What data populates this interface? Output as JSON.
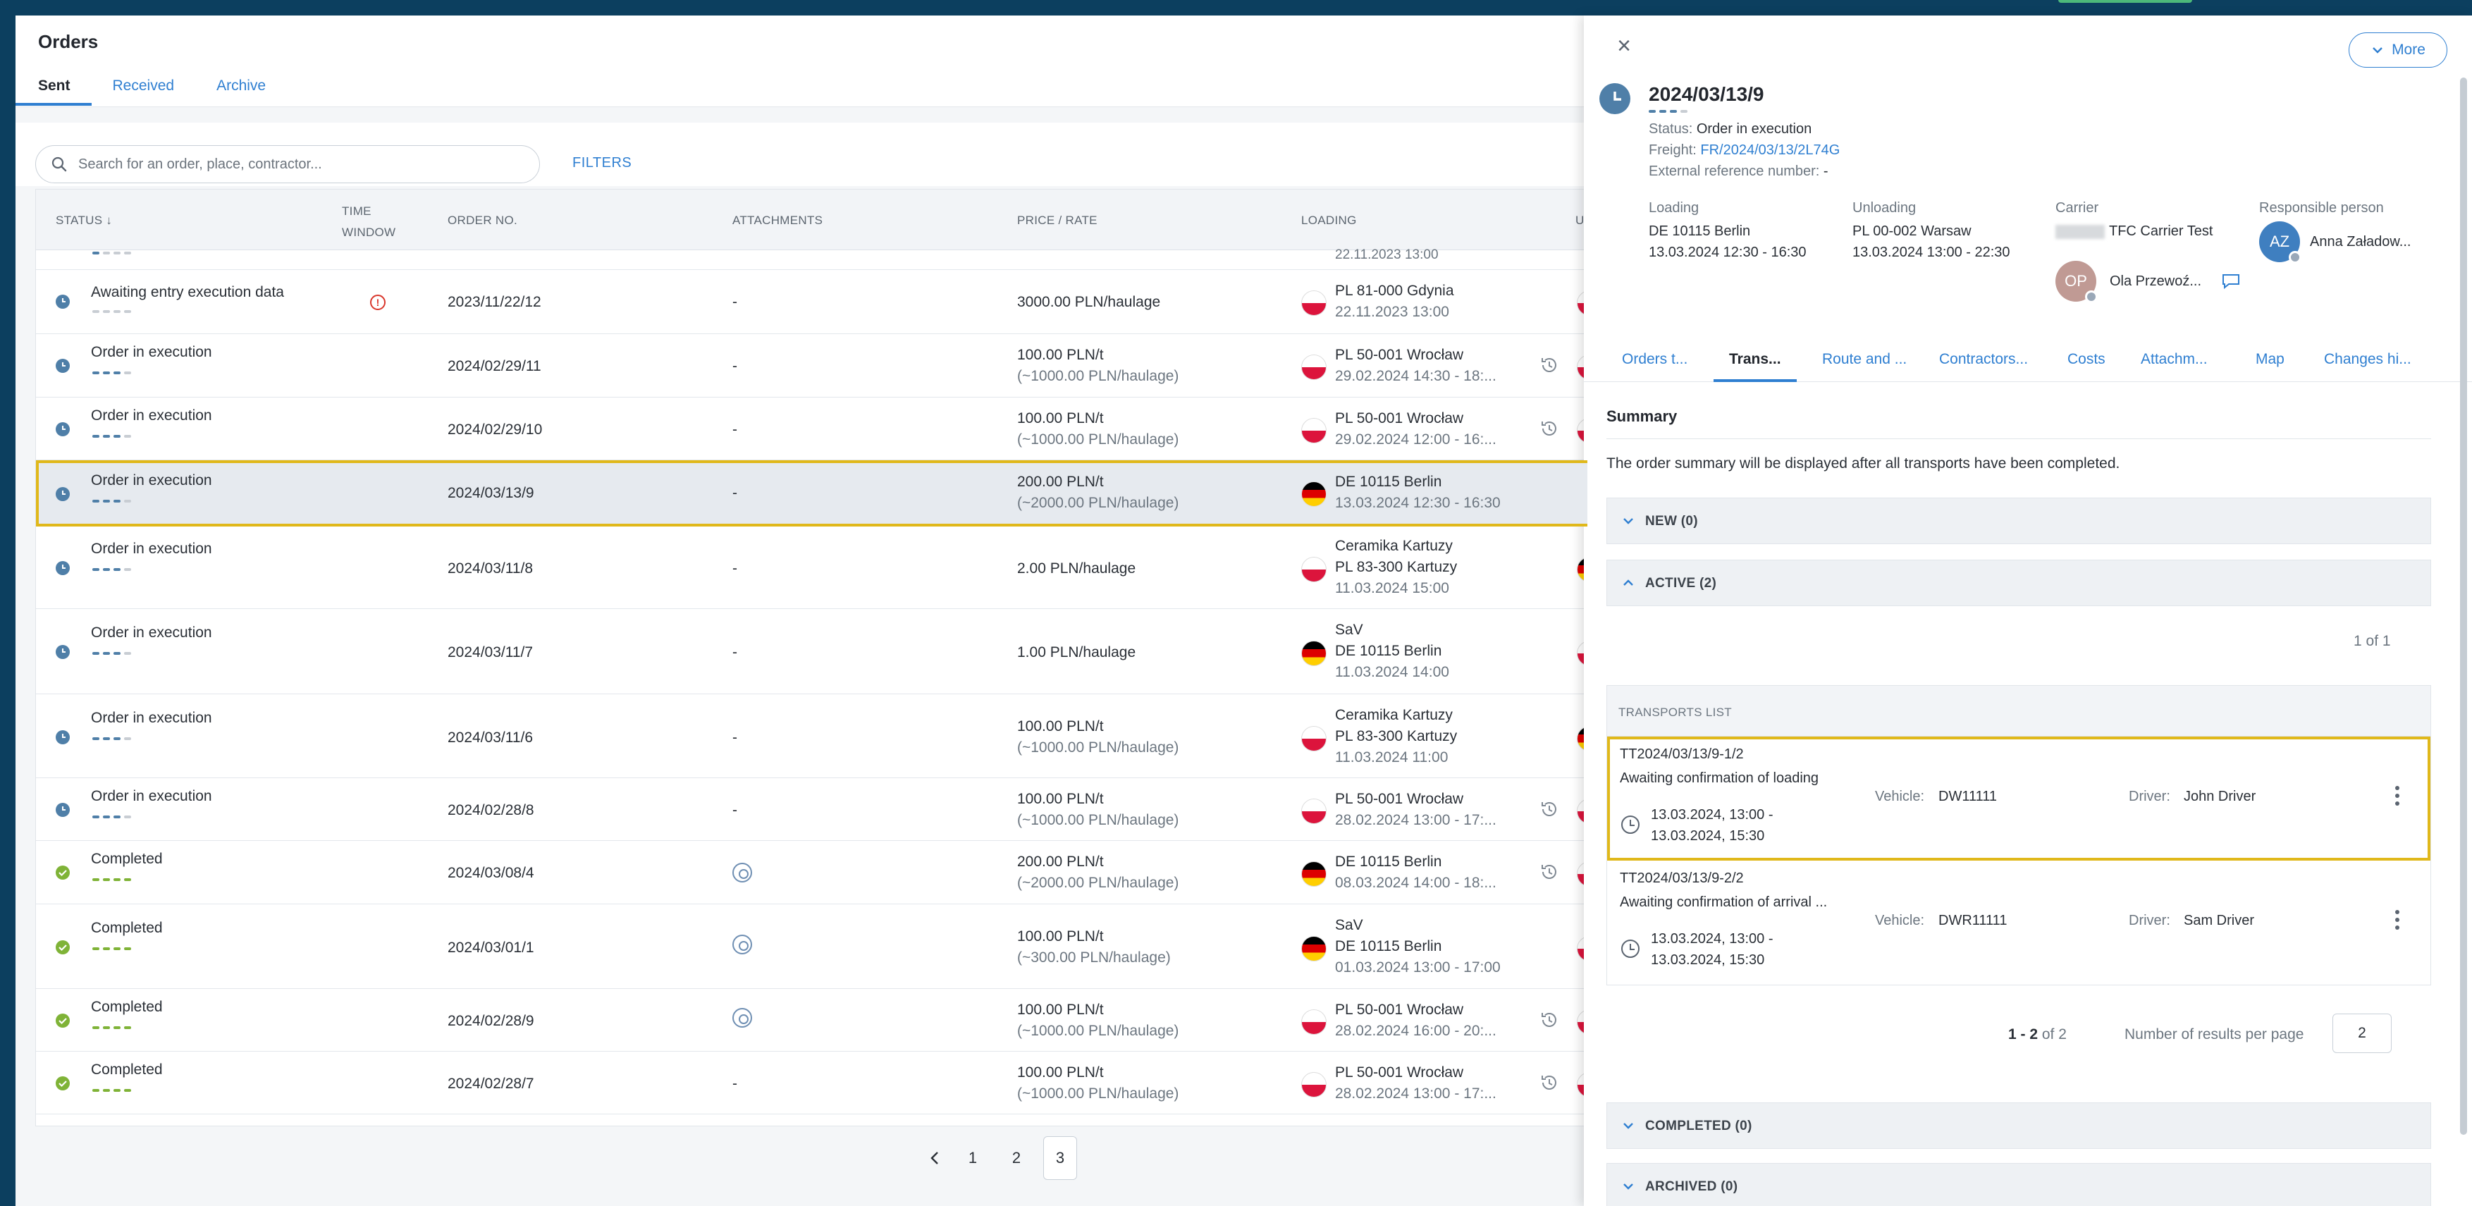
{
  "page_title": "Orders",
  "tabs": [
    "Sent",
    "Received",
    "Archive"
  ],
  "search": {
    "placeholder": "Search for an order, place, contractor..."
  },
  "filters_label": "FILTERS",
  "columns": {
    "status": "STATUS ↓",
    "time_window": "TIME WINDOW",
    "order_no": "ORDER NO.",
    "attachments": "ATTACHMENTS",
    "price": "PRICE / RATE",
    "loading": "LOADING",
    "unloading_partial": "U"
  },
  "partial_top_row": {
    "loading_sub": "22.11.2023 13:00"
  },
  "rows": [
    {
      "status": "Awaiting entry execution data",
      "order_no": "2023/11/22/12",
      "attachments": "-",
      "price": "3000.00 PLN/haulage",
      "price_sub": "",
      "loading_1": "PL 81-000 Gdynia",
      "loading_2": "22.11.2023 13:00",
      "loading_3": ""
    },
    {
      "status": "Order in execution",
      "order_no": "2024/02/29/11",
      "attachments": "-",
      "price": "100.00 PLN/t",
      "price_sub": "(~1000.00 PLN/haulage)",
      "loading_1": "PL 50-001 Wrocław",
      "loading_2": "29.02.2024 14:30 - 18:...",
      "loading_3": ""
    },
    {
      "status": "Order in execution",
      "order_no": "2024/02/29/10",
      "attachments": "-",
      "price": "100.00 PLN/t",
      "price_sub": "(~1000.00 PLN/haulage)",
      "loading_1": "PL 50-001 Wrocław",
      "loading_2": "29.02.2024 12:00 - 16:...",
      "loading_3": ""
    },
    {
      "status": "Order in execution",
      "order_no": "2024/03/13/9",
      "attachments": "-",
      "price": "200.00 PLN/t",
      "price_sub": "(~2000.00 PLN/haulage)",
      "loading_1": "DE 10115 Berlin",
      "loading_2": "13.03.2024 12:30 - 16:30",
      "loading_3": ""
    },
    {
      "status": "Order in execution",
      "order_no": "2024/03/11/8",
      "attachments": "-",
      "price": "2.00 PLN/haulage",
      "price_sub": "",
      "loading_1": "Ceramika Kartuzy",
      "loading_2": "PL 83-300 Kartuzy",
      "loading_3": "11.03.2024 15:00"
    },
    {
      "status": "Order in execution",
      "order_no": "2024/03/11/7",
      "attachments": "-",
      "price": "1.00 PLN/haulage",
      "price_sub": "",
      "loading_1": "SaV",
      "loading_2": "DE 10115 Berlin",
      "loading_3": "11.03.2024 14:00"
    },
    {
      "status": "Order in execution",
      "order_no": "2024/03/11/6",
      "attachments": "-",
      "price": "100.00 PLN/t",
      "price_sub": "(~1000.00 PLN/haulage)",
      "loading_1": "Ceramika Kartuzy",
      "loading_2": "PL 83-300 Kartuzy",
      "loading_3": "11.03.2024 11:00"
    },
    {
      "status": "Order in execution",
      "order_no": "2024/02/28/8",
      "attachments": "-",
      "price": "100.00 PLN/t",
      "price_sub": "(~1000.00 PLN/haulage)",
      "loading_1": "PL 50-001 Wrocław",
      "loading_2": "28.02.2024 13:00 - 17:...",
      "loading_3": ""
    },
    {
      "status": "Completed",
      "order_no": "2024/03/08/4",
      "attachments": "",
      "price": "200.00 PLN/t",
      "price_sub": "(~2000.00 PLN/haulage)",
      "loading_1": "DE 10115 Berlin",
      "loading_2": "08.03.2024 14:00 - 18:...",
      "loading_3": ""
    },
    {
      "status": "Completed",
      "order_no": "2024/03/01/1",
      "attachments": "",
      "price": "100.00 PLN/t",
      "price_sub": "(~300.00 PLN/haulage)",
      "loading_1": "SaV",
      "loading_2": "DE 10115 Berlin",
      "loading_3": "01.03.2024 13:00 - 17:00"
    },
    {
      "status": "Completed",
      "order_no": "2024/02/28/9",
      "attachments": "",
      "price": "100.00 PLN/t",
      "price_sub": "(~1000.00 PLN/haulage)",
      "loading_1": "PL 50-001 Wrocław",
      "loading_2": "28.02.2024 16:00 - 20:...",
      "loading_3": ""
    },
    {
      "status": "Completed",
      "order_no": "2024/02/28/7",
      "attachments": "-",
      "price": "100.00 PLN/t",
      "price_sub": "(~1000.00 PLN/haulage)",
      "loading_1": "PL 50-001 Wrocław",
      "loading_2": "28.02.2024 13:00 - 17:...",
      "loading_3": ""
    }
  ],
  "pagination": [
    "1",
    "2",
    "3"
  ],
  "detail": {
    "more_label": "More",
    "order_no": "2024/03/13/9",
    "status_label": "Status:",
    "status_value": "Order in execution",
    "freight_label": "Freight:",
    "freight_value": "FR/2024/03/13/2L74G",
    "extref_label": "External reference number:",
    "extref_value": "-",
    "loading_label": "Loading",
    "loading_place": "DE 10115 Berlin",
    "loading_time": "13.03.2024 12:30 - 16:30",
    "unloading_label": "Unloading",
    "unloading_place": "PL 00-002 Warsaw",
    "unloading_time": "13.03.2024 13:00 - 22:30",
    "carrier_label": "Carrier",
    "carrier_name": "TFC Carrier Test",
    "carrier_person_initials": "OP",
    "carrier_person": "Ola Przewoź...",
    "responsible_label": "Responsible person",
    "responsible_initials": "AZ",
    "responsible_name": "Anna Załadow...",
    "tabs": [
      "Orders t...",
      "Trans...",
      "Route and ...",
      "Contractors...",
      "Costs",
      "Attachm...",
      "Map",
      "Changes hi..."
    ],
    "summary_title": "Summary",
    "summary_text": "The order summary will be displayed after all transports have been completed.",
    "section_new": "NEW (0)",
    "section_active": "ACTIVE (2)",
    "counter": "1 of 1",
    "transports_list": "TRANSPORTS LIST",
    "transports": [
      {
        "id": "TT2024/03/13/9-1/2",
        "status": "Awaiting confirmation of loading",
        "date_1": "13.03.2024, 13:00 -",
        "date_2": "13.03.2024, 15:30",
        "vehicle_label": "Vehicle:",
        "vehicle": "DW11111",
        "driver_label": "Driver:",
        "driver": "John Driver"
      },
      {
        "id": "TT2024/03/13/9-2/2",
        "status": "Awaiting confirmation of arrival ...",
        "date_1": "13.03.2024, 13:00 -",
        "date_2": "13.03.2024, 15:30",
        "vehicle_label": "Vehicle:",
        "vehicle": "DWR11111",
        "driver_label": "Driver:",
        "driver": "Sam Driver"
      }
    ],
    "results_range": "1 - 2",
    "results_of": "of 2",
    "results_per_label": "Number of results per page",
    "results_per": "2",
    "section_completed": "COMPLETED (0)",
    "section_archived": "ARCHIVED (0)"
  }
}
